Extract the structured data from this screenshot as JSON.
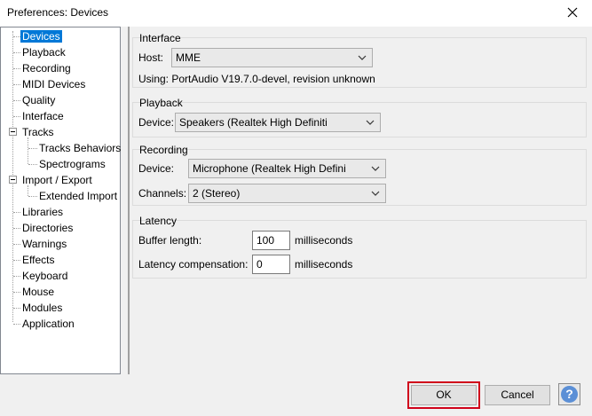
{
  "window": {
    "title": "Preferences: Devices",
    "close_icon": "close-icon"
  },
  "tree": {
    "items": [
      {
        "label": "Devices",
        "selected": true
      },
      {
        "label": "Playback"
      },
      {
        "label": "Recording"
      },
      {
        "label": "MIDI Devices"
      },
      {
        "label": "Quality"
      },
      {
        "label": "Interface"
      },
      {
        "label": "Tracks",
        "expander": "minus"
      },
      {
        "label": "Tracks Behaviors",
        "child": true
      },
      {
        "label": "Spectrograms",
        "child": true
      },
      {
        "label": "Import / Export",
        "expander": "minus"
      },
      {
        "label": "Extended Import",
        "child": true
      },
      {
        "label": "Libraries"
      },
      {
        "label": "Directories"
      },
      {
        "label": "Warnings"
      },
      {
        "label": "Effects"
      },
      {
        "label": "Keyboard"
      },
      {
        "label": "Mouse"
      },
      {
        "label": "Modules"
      },
      {
        "label": "Application"
      }
    ]
  },
  "interface": {
    "title": "Interface",
    "host_label": "Host:",
    "host_value": "MME",
    "using_text": "Using: PortAudio V19.7.0-devel, revision unknown"
  },
  "playback": {
    "title": "Playback",
    "device_label": "Device:",
    "device_value": "Speakers (Realtek High Definiti"
  },
  "recording": {
    "title": "Recording",
    "device_label": "Device:",
    "device_value": "Microphone (Realtek High Defini",
    "channels_label": "Channels:",
    "channels_value": "2 (Stereo)"
  },
  "latency": {
    "title": "Latency",
    "buffer_label": "Buffer length:",
    "buffer_value": "100",
    "buffer_unit": "milliseconds",
    "comp_label": "Latency compensation:",
    "comp_value": "0",
    "comp_unit": "milliseconds"
  },
  "buttons": {
    "ok": "OK",
    "cancel": "Cancel",
    "help": "?"
  },
  "colors": {
    "highlight": "#d0021b",
    "selection": "#0078d7"
  }
}
